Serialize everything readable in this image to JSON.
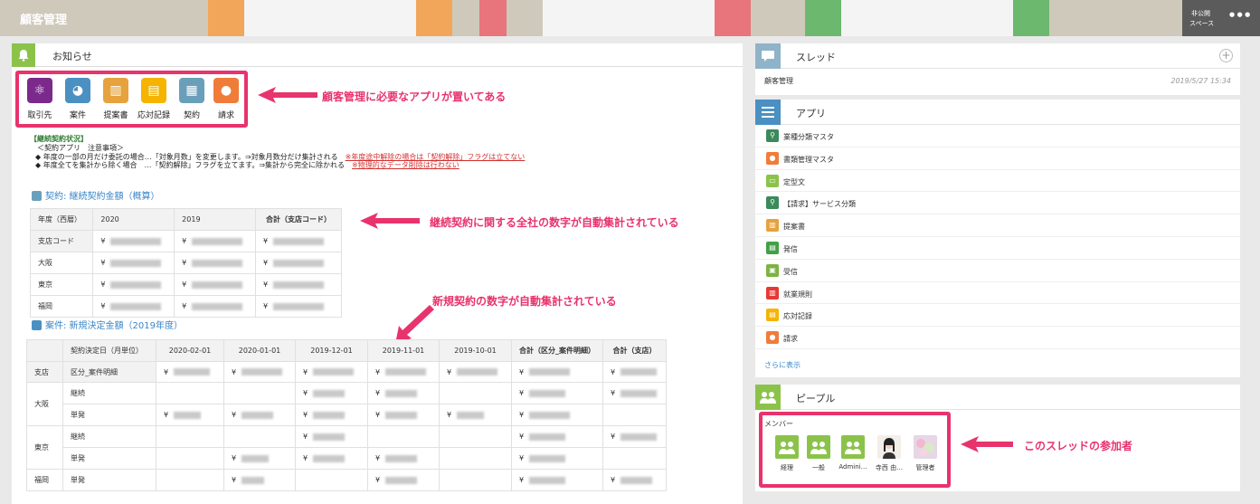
{
  "topbar": {
    "title": "顧客管理",
    "privacy": "非公開",
    "space_label": "スペース",
    "more": "•••"
  },
  "notices": {
    "title": "お知らせ",
    "apps": [
      {
        "label": "取引先",
        "icon": "atom-icon",
        "color": "#7b2a8c"
      },
      {
        "label": "案件",
        "icon": "pie-chart-icon",
        "color": "#4a90c2"
      },
      {
        "label": "提案書",
        "icon": "document-chart-icon",
        "color": "#e6a23c"
      },
      {
        "label": "応対記録",
        "icon": "clipboard-icon",
        "color": "#f5b400"
      },
      {
        "label": "契約",
        "icon": "contract-icon",
        "color": "#6a9fba"
      },
      {
        "label": "請求",
        "icon": "piggy-bank-icon",
        "color": "#f07c3a"
      }
    ],
    "annot_apps": "顧客管理に必要なアプリが置いてある",
    "notice_heading": "【継続契約状況】",
    "notice_line1": "＜契約アプリ　注意事項＞",
    "notice_line2a": "◆ 年度の一部の月だけ委託の場合…「対象月数」を変更します。⇒対象月数分だけ集計される",
    "notice_line2b": "※年度途中解除の場合は「契約解除」フラグは立てない",
    "notice_line3a": "◆ 年度全てを集計から除く場合　…「契約解除」フラグを立てます。⇒集計から完全に除かれる",
    "notice_line3b": "※物理的なデータ削除は行わない",
    "contract_title": "契約: 継続契約金額（概算）",
    "contract_headers": [
      "年度（西暦）",
      "2020",
      "2019",
      "合計（支店コード）"
    ],
    "contract_rows": [
      [
        "支店コード",
        "¥",
        "¥",
        "¥"
      ],
      [
        "大阪",
        "¥",
        "¥",
        "¥"
      ],
      [
        "東京",
        "¥",
        "¥",
        "¥"
      ],
      [
        "福岡",
        "¥",
        "¥",
        "¥"
      ]
    ],
    "annot_contract": "継続契約に関する全社の数字が自動集計されている",
    "annot_new": "新規契約の数字が自動集計されている",
    "deal_title": "案件: 新規決定金額（2019年度）",
    "deal_headers": [
      "",
      "契約決定日（月単位）",
      "2020-02-01",
      "2020-01-01",
      "2019-12-01",
      "2019-11-01",
      "2019-10-01",
      "合計（区分_案件明細）",
      "合計（支店）"
    ],
    "deal_row_branch": "支店",
    "deal_row_detail": "区分_案件明細",
    "deal_osaka": "大阪",
    "deal_tokyo": "東京",
    "deal_fukuoka": "福岡",
    "deal_keizoku": "継続",
    "deal_tanpatsu": "単発",
    "yen": "¥"
  },
  "thread": {
    "title": "スレッド",
    "plus": "+",
    "name": "顧客管理",
    "date": "2019/5/27 15:34"
  },
  "apps_panel": {
    "title": "アプリ",
    "items": [
      {
        "label": "業種分類マスタ",
        "icon": "key-icon",
        "color": "#3a8a5a"
      },
      {
        "label": "書類管理マスタ",
        "icon": "person-icon",
        "color": "#f07c3a"
      },
      {
        "label": "定型文",
        "icon": "message-icon",
        "color": "#8bc34a"
      },
      {
        "label": "【請求】サービス分類",
        "icon": "key-icon",
        "color": "#3a8a5a"
      },
      {
        "label": "提案書",
        "icon": "document-chart-icon",
        "color": "#e6a23c"
      },
      {
        "label": "発信",
        "icon": "printer-icon",
        "color": "#43a047"
      },
      {
        "label": "受信",
        "icon": "inbox-icon",
        "color": "#7cb342"
      },
      {
        "label": "就業規則",
        "icon": "book-icon",
        "color": "#e53935"
      },
      {
        "label": "応対記録",
        "icon": "clipboard-icon",
        "color": "#f5b400"
      },
      {
        "label": "請求",
        "icon": "piggy-bank-icon",
        "color": "#f07c3a"
      }
    ],
    "more": "さらに表示"
  },
  "people": {
    "title": "ピープル",
    "members_label": "メンバー",
    "members": [
      {
        "name": "経理",
        "icon": "group-icon"
      },
      {
        "name": "一般",
        "icon": "group-icon"
      },
      {
        "name": "Admini…",
        "icon": "group-icon"
      },
      {
        "name": "寺西 由…",
        "icon": "user-photo-icon"
      },
      {
        "name": "管理者",
        "icon": "user-photo-icon"
      }
    ],
    "annot": "このスレッドの参加者"
  }
}
